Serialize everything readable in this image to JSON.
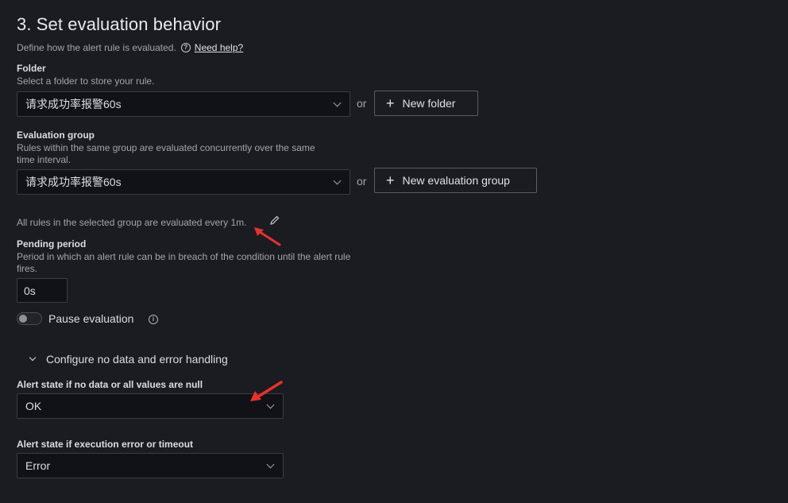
{
  "section": {
    "title": "3. Set evaluation behavior",
    "description": "Define how the alert rule is evaluated.",
    "help_link": "Need help?"
  },
  "folder": {
    "label": "Folder",
    "description": "Select a folder to store your rule.",
    "selected": "请求成功率报警60s",
    "or": "or",
    "new_button": "New folder"
  },
  "group": {
    "label": "Evaluation group",
    "description_line1": "Rules within the same group are evaluated concurrently over the same",
    "description_line2": "time interval.",
    "selected": "请求成功率报警60s",
    "or": "or",
    "new_button": "New evaluation group",
    "interval_text": "All rules in the selected group are evaluated every 1m."
  },
  "pending": {
    "label": "Pending period",
    "description_line1": "Period in which an alert rule can be in breach of the condition until the alert rule",
    "description_line2": "fires.",
    "value": "0s"
  },
  "pause": {
    "label": "Pause evaluation",
    "enabled": false
  },
  "handling": {
    "section_label": "Configure no data and error handling",
    "no_data_label": "Alert state if no data or all values are null",
    "no_data_value": "OK",
    "error_label": "Alert state if execution error or timeout",
    "error_value": "Error"
  },
  "colors": {
    "background": "#1b1c21",
    "annotation_arrow": "#e8312a"
  },
  "icons": [
    "help-circle-icon",
    "chevron-down-icon",
    "plus-icon",
    "pencil-icon",
    "info-icon",
    "chevron-expand-icon",
    "red-arrow-annotation"
  ]
}
